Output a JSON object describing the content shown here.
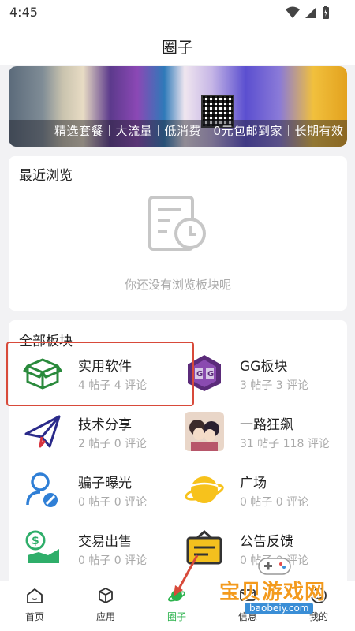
{
  "status": {
    "time": "4:45"
  },
  "header": {
    "title": "圈子"
  },
  "banner": {
    "caption": "精选套餐｜大流量｜低消费｜0元包邮到家｜长期有效"
  },
  "recent": {
    "title": "最近浏览",
    "empty_text": "你还没有浏览板块呢"
  },
  "all_boards": {
    "title": "全部板块",
    "items": [
      {
        "name": "实用软件",
        "stats": "4 帖子 4 评论",
        "icon": "box-icon"
      },
      {
        "name": "GG板块",
        "stats": "3 帖子 3 评论",
        "icon": "gg-logo-icon"
      },
      {
        "name": "技术分享",
        "stats": "2 帖子 0 评论",
        "icon": "paper-plane-icon"
      },
      {
        "name": "一路狂飙",
        "stats": "31 帖子 118 评论",
        "icon": "anime-avatar-icon"
      },
      {
        "name": "骗子曝光",
        "stats": "0 帖子 0 评论",
        "icon": "user-block-icon"
      },
      {
        "name": "广场",
        "stats": "0 帖子 0 评论",
        "icon": "planet-icon"
      },
      {
        "name": "交易出售",
        "stats": "0 帖子 0 评论",
        "icon": "dollar-hand-icon"
      },
      {
        "name": "公告反馈",
        "stats": "0 帖子 0 评论",
        "icon": "announcement-box-icon"
      }
    ]
  },
  "tabbar": {
    "items": [
      {
        "label": "首页",
        "icon": "home-icon"
      },
      {
        "label": "应用",
        "icon": "cube-icon"
      },
      {
        "label": "圈子",
        "icon": "planet-icon"
      },
      {
        "label": "信息",
        "icon": "message-icon"
      },
      {
        "label": "我的",
        "icon": "profile-icon"
      }
    ],
    "active": "圈子"
  },
  "watermark": {
    "text": "宝贝游戏网",
    "url": "baobeiy.com"
  },
  "colors": {
    "accent": "#2bb24c",
    "highlight_border": "#d84a3a"
  }
}
